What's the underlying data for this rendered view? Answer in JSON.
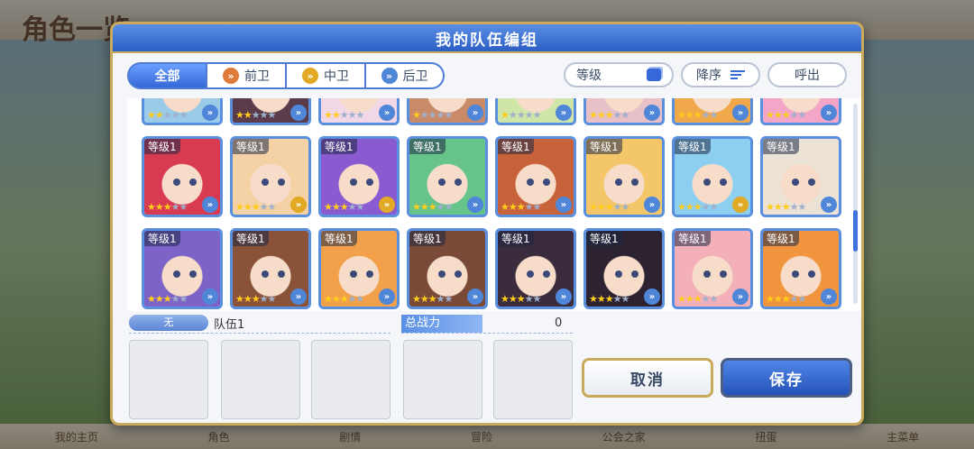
{
  "background": {
    "title": "角色一览",
    "bottom_nav": [
      "我的主页",
      "角色",
      "剧情",
      "冒险",
      "公会之家",
      "扭蛋",
      "主菜单"
    ]
  },
  "dialog": {
    "title": "我的队伍编组",
    "filters": [
      {
        "label": "全部",
        "active": true
      },
      {
        "label": "前卫",
        "icon": "front-role-icon"
      },
      {
        "label": "中卫",
        "icon": "middle-role-icon"
      },
      {
        "label": "后卫",
        "icon": "back-role-icon"
      }
    ],
    "sort_field_label": "等级",
    "sort_order_label": "降序",
    "call_label": "呼出",
    "cards": [
      {
        "level": "",
        "stars": 2,
        "role": "back",
        "color": "#9ccbe8"
      },
      {
        "level": "",
        "stars": 2,
        "role": "back",
        "color": "#5a3b4a"
      },
      {
        "level": "",
        "stars": 2,
        "role": "back",
        "color": "#f2d7e6"
      },
      {
        "level": "",
        "stars": 1,
        "role": "back",
        "color": "#c98a6a"
      },
      {
        "level": "",
        "stars": 1,
        "role": "back",
        "color": "#cfe6a8"
      },
      {
        "level": "",
        "stars": 3,
        "role": "back",
        "color": "#e8c0c8"
      },
      {
        "level": "",
        "stars": 3,
        "role": "back",
        "color": "#f0a84a"
      },
      {
        "level": "",
        "stars": 3,
        "role": "back",
        "color": "#f3a6c8"
      },
      {
        "level": "等级1",
        "stars": 3,
        "role": "back",
        "color": "#d83a52"
      },
      {
        "level": "等级1",
        "stars": 3,
        "role": "mid",
        "color": "#f4d2a6"
      },
      {
        "level": "等级1",
        "stars": 3,
        "role": "mid",
        "color": "#8a5ad0"
      },
      {
        "level": "等级1",
        "stars": 3,
        "role": "back",
        "color": "#66c38a"
      },
      {
        "level": "等级1",
        "stars": 3,
        "role": "back",
        "color": "#c8623a"
      },
      {
        "level": "等级1",
        "stars": 3,
        "role": "back",
        "color": "#f4c66a"
      },
      {
        "level": "等级1",
        "stars": 3,
        "role": "mid",
        "color": "#8ccff0"
      },
      {
        "level": "等级1",
        "stars": 3,
        "role": "back",
        "color": "#ece3d6"
      },
      {
        "level": "等级1",
        "stars": 3,
        "role": "back",
        "color": "#7d62c8"
      },
      {
        "level": "等级1",
        "stars": 3,
        "role": "back",
        "color": "#8a5238"
      },
      {
        "level": "等级1",
        "stars": 3,
        "role": "back",
        "color": "#f2a04a"
      },
      {
        "level": "等级1",
        "stars": 3,
        "role": "back",
        "color": "#7a4a38"
      },
      {
        "level": "等级1",
        "stars": 3,
        "role": "back",
        "color": "#3a2c3c"
      },
      {
        "level": "等级1",
        "stars": 3,
        "role": "back",
        "color": "#2c2230"
      },
      {
        "level": "等级1",
        "stars": 3,
        "role": "back",
        "color": "#f3b0b8"
      },
      {
        "level": "等级1",
        "stars": 3,
        "role": "back",
        "color": "#f0953e"
      }
    ],
    "team_tag": "无",
    "team_name": "队伍1",
    "power_label": "总战力",
    "power_value": "0",
    "cancel_label": "取消",
    "save_label": "保存",
    "colors": {
      "accent": "#3668d8",
      "gold_border": "#c9a95a",
      "star": "#ffcc1a"
    }
  }
}
